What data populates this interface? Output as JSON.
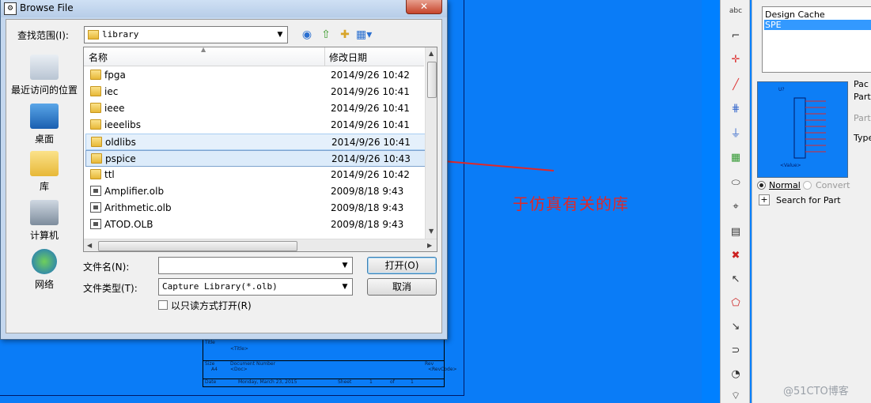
{
  "dialog": {
    "title": "Browse File",
    "close_label": "✕",
    "lookin_label": "查找范围(I):",
    "lookin_value": "library",
    "places": [
      {
        "label": "最近访问的位置"
      },
      {
        "label": "桌面"
      },
      {
        "label": "库"
      },
      {
        "label": "计算机"
      },
      {
        "label": "网络"
      }
    ],
    "columns": {
      "name": "名称",
      "date": "修改日期"
    },
    "files": [
      {
        "name": "fpga",
        "date": "2014/9/26 10:42",
        "type": "folder"
      },
      {
        "name": "iec",
        "date": "2014/9/26 10:41",
        "type": "folder"
      },
      {
        "name": "ieee",
        "date": "2014/9/26 10:41",
        "type": "folder"
      },
      {
        "name": "ieeelibs",
        "date": "2014/9/26 10:41",
        "type": "folder"
      },
      {
        "name": "oldlibs",
        "date": "2014/9/26 10:41",
        "type": "folder"
      },
      {
        "name": "pspice",
        "date": "2014/9/26 10:43",
        "type": "folder"
      },
      {
        "name": "ttl",
        "date": "2014/9/26 10:42",
        "type": "folder"
      },
      {
        "name": "Amplifier.olb",
        "date": "2009/8/18 9:43",
        "type": "file"
      },
      {
        "name": "Arithmetic.olb",
        "date": "2009/8/18 9:43",
        "type": "file"
      },
      {
        "name": "ATOD.OLB",
        "date": "2009/8/18 9:43",
        "type": "file"
      }
    ],
    "filename_label": "文件名(N):",
    "filename_value": "",
    "filetype_label": "文件类型(T):",
    "filetype_value": "Capture Library(*.olb)",
    "readonly_label": "以只读方式打开(R)",
    "open_label": "打开(O)",
    "cancel_label": "取消"
  },
  "annotation": {
    "text": "于仿真有关的库"
  },
  "titleblock": {
    "title_label": "Title",
    "title_value": "<Title>",
    "size_label": "Size",
    "size_value": "A4",
    "docnum_label": "Document Number",
    "doc_value": "<Doc>",
    "rev_label": "Rev",
    "rev_value": "<RevCode>",
    "date_label": "Date",
    "date_value": "Monday, March 23, 2015",
    "sheet_label": "Sheet",
    "sheet_value": "1",
    "of_label": "of",
    "of_value": "1"
  },
  "right_panel": {
    "libraries": [
      "Design Cache",
      "SPE"
    ],
    "selected_library": 1,
    "part_header": "Pac",
    "parts_label": "Parts",
    "part_label": "Part:",
    "type_label": "Type",
    "preview_ref": "U?",
    "preview_value": "<Value>",
    "normal_label": "Normal",
    "convert_label": "Convert",
    "search_label": "Search for Part"
  },
  "toolbar": {
    "tools": [
      "abc-icon",
      "wire-icon",
      "junction-icon",
      "no-connect-icon",
      "bus-icon",
      "ground-icon",
      "part-icon",
      "text-icon",
      "net-alias-icon",
      "place-pin-icon",
      "delete-icon",
      "select-icon",
      "select-area-icon",
      "select-part-icon",
      "select-net-icon",
      "select-shape-icon",
      "select-more-icon"
    ]
  },
  "watermark": "@51CTO博客",
  "colors": {
    "canvas": "#0a7cf7",
    "annotation": "#e02828",
    "selection": "#3399ff"
  }
}
